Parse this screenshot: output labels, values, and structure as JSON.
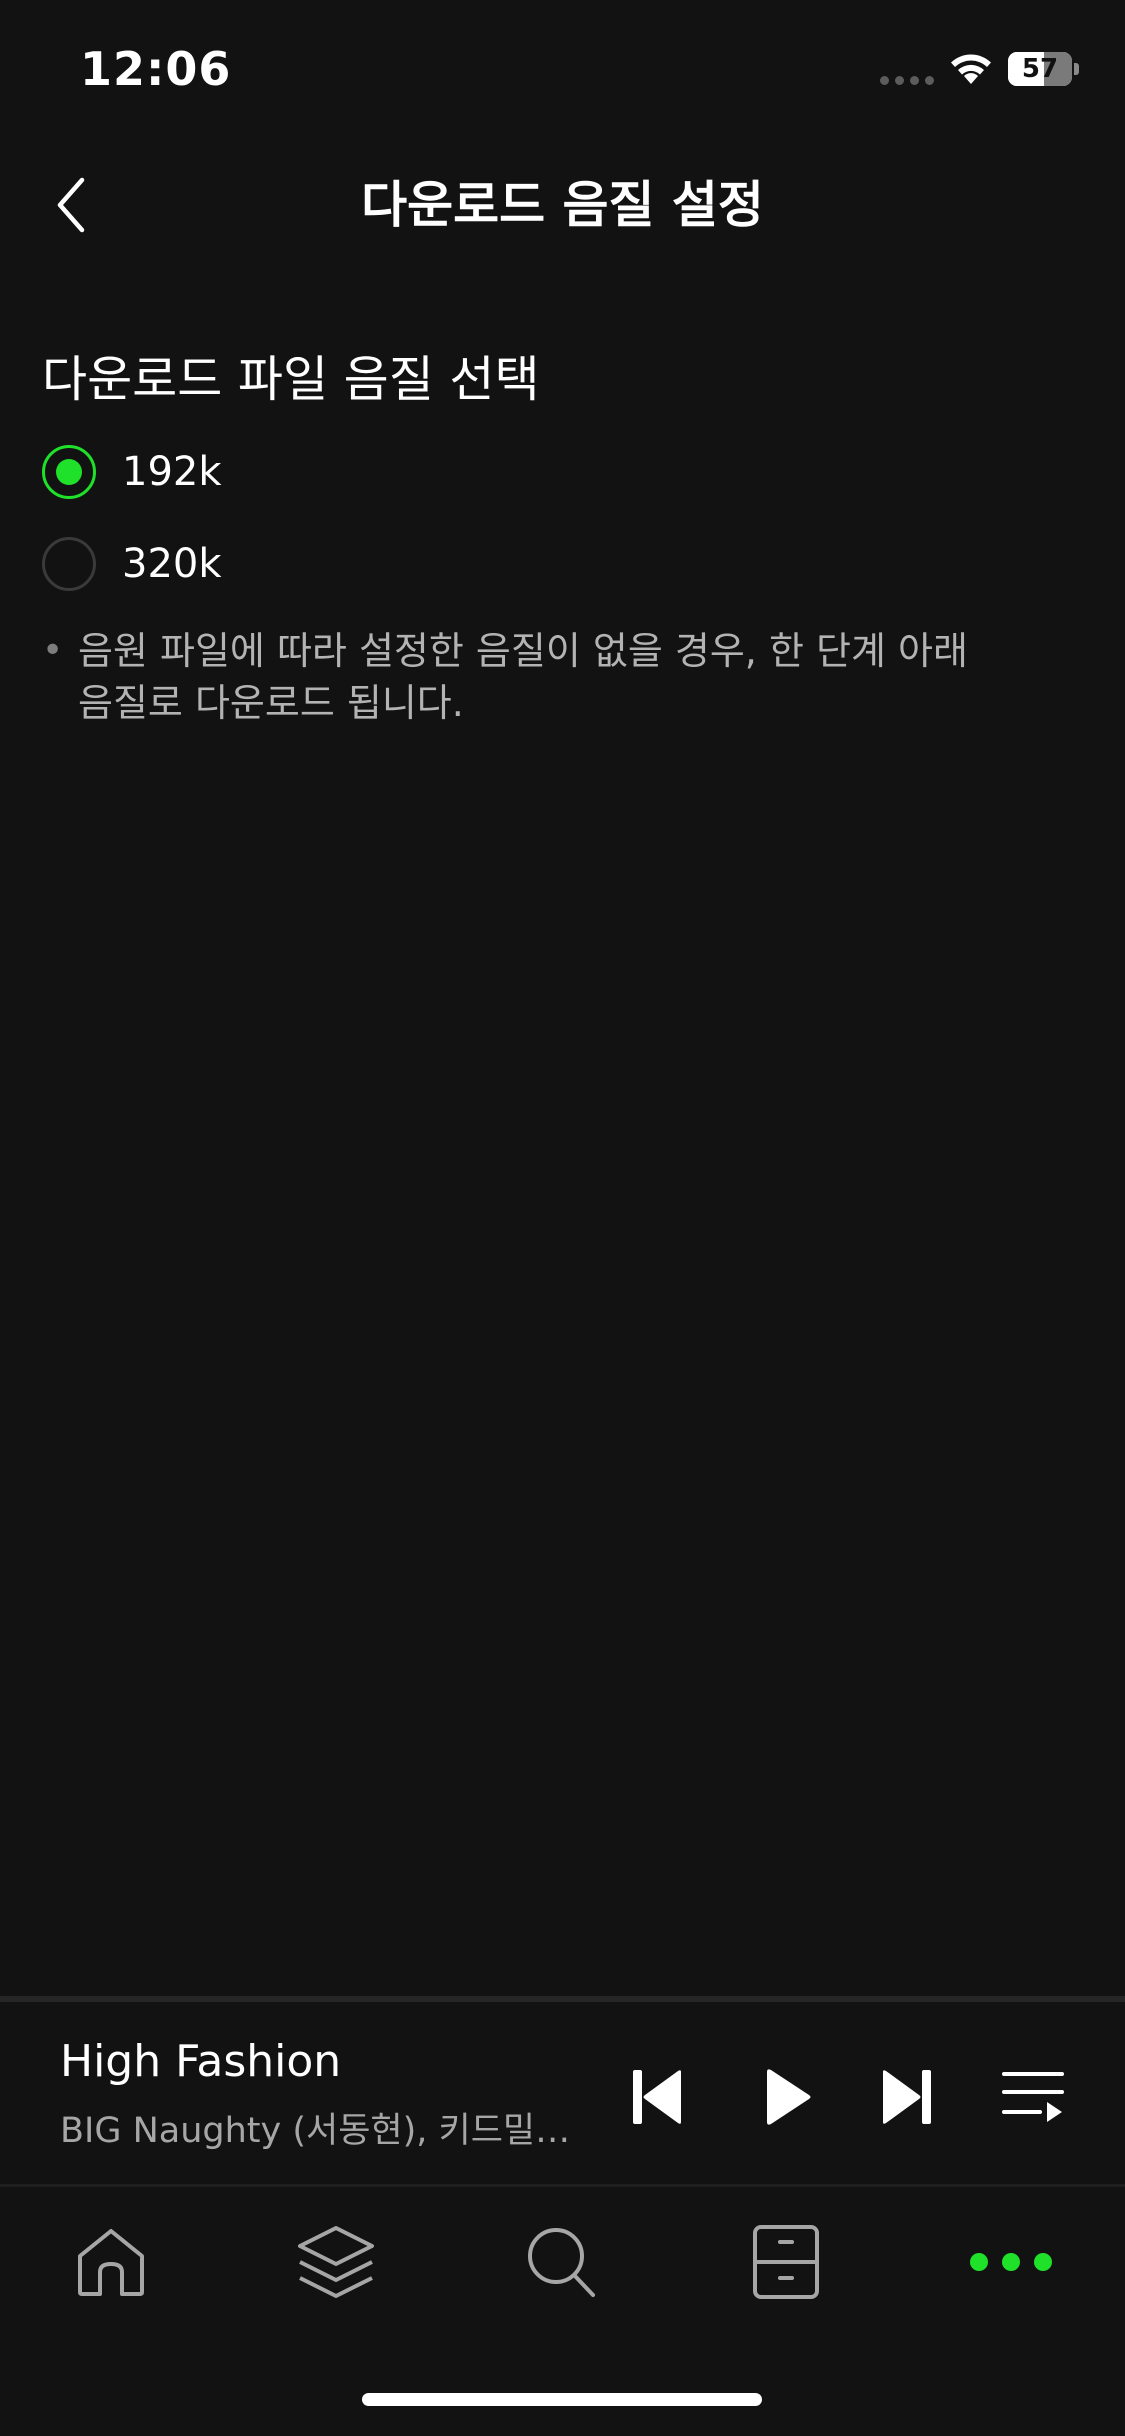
{
  "status_bar": {
    "time": "12:06",
    "battery_level": "57"
  },
  "nav": {
    "title": "다운로드 음질 설정"
  },
  "settings": {
    "section_title": "다운로드 파일 음질 선택",
    "options": [
      {
        "label": "192k",
        "selected": true
      },
      {
        "label": "320k",
        "selected": false
      }
    ],
    "note_bullet": "•",
    "note": "음원 파일에 따라 설정한 음질이 없을 경우, 한 단계 아래\n음질로 다운로드 됩니다."
  },
  "mini_player": {
    "track_title": "High Fashion",
    "artist": "BIG Naughty (서동현), 키드밀리..."
  },
  "tabs": [
    "home-icon",
    "layers-icon",
    "search-icon",
    "library-icon",
    "more-icon"
  ],
  "colors": {
    "background": "#121212",
    "accent": "#1fe12a",
    "secondary_text": "#b3b3b3"
  }
}
